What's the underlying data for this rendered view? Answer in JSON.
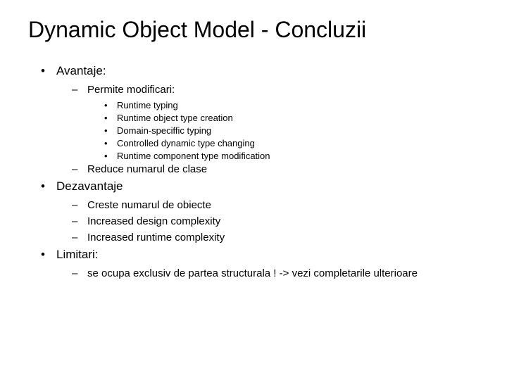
{
  "title": "Dynamic Object Model - Concluzii",
  "sections": [
    {
      "label": "Avantaje:",
      "children": [
        {
          "label": "Permite modificari:",
          "children": [
            {
              "label": "Runtime typing"
            },
            {
              "label": "Runtime object type creation"
            },
            {
              "label": "Domain-speciffic typing"
            },
            {
              "label": "Controlled dynamic type changing"
            },
            {
              "label": "Runtime component type modification"
            }
          ]
        },
        {
          "label": "Reduce numarul de clase"
        }
      ]
    },
    {
      "label": "Dezavantaje",
      "children": [
        {
          "label": "Creste numarul de obiecte"
        },
        {
          "label": "Increased design complexity"
        },
        {
          "label": "Increased runtime complexity"
        }
      ]
    },
    {
      "label": "Limitari:",
      "children": [
        {
          "label": "se ocupa exclusiv de partea structurala ! -> vezi completarile ulterioare"
        }
      ]
    }
  ],
  "bullets": {
    "l1": "•",
    "l2": "–",
    "l3": "•"
  }
}
